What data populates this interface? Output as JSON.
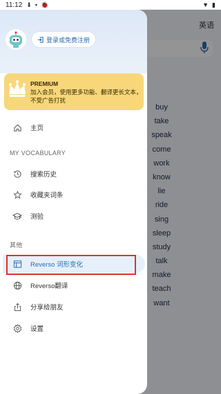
{
  "status_bar": {
    "time": "11:12",
    "icons": [
      "download-icon",
      "square-icon",
      "bug-icon"
    ],
    "right_icons": [
      "wifi-icon",
      "battery-icon"
    ]
  },
  "background": {
    "language": "英语",
    "words": [
      "buy",
      "take",
      "speak",
      "come",
      "work",
      "know",
      "lie",
      "ride",
      "sing",
      "sleep",
      "study",
      "talk",
      "make",
      "teach",
      "want"
    ]
  },
  "drawer": {
    "login_label": "登录或免费注册",
    "premium": {
      "title": "PREMIUM",
      "description": "加入会员，使用更多功能、翻译更长文本，不受广告打扰"
    },
    "home_label": "主页",
    "vocab_section": "MY VOCABULARY",
    "vocab_items": [
      {
        "label": "搜索历史",
        "icon": "history-icon"
      },
      {
        "label": "收藏夹词条",
        "icon": "star-icon"
      },
      {
        "label": "测验",
        "icon": "graduation-cap-icon"
      }
    ],
    "other_section": "其他",
    "other_items": [
      {
        "label": "Reverso 词形变化",
        "icon": "table-icon"
      },
      {
        "label": "Reverso翻译",
        "icon": "globe-icon"
      },
      {
        "label": "分享给朋友",
        "icon": "share-icon"
      },
      {
        "label": "设置",
        "icon": "gear-icon"
      }
    ]
  },
  "colors": {
    "accent": "#2b6cb0",
    "premium_bg": "#f7d77a",
    "highlight_border": "#e0302b",
    "drawer_header": "#dce8f7"
  }
}
